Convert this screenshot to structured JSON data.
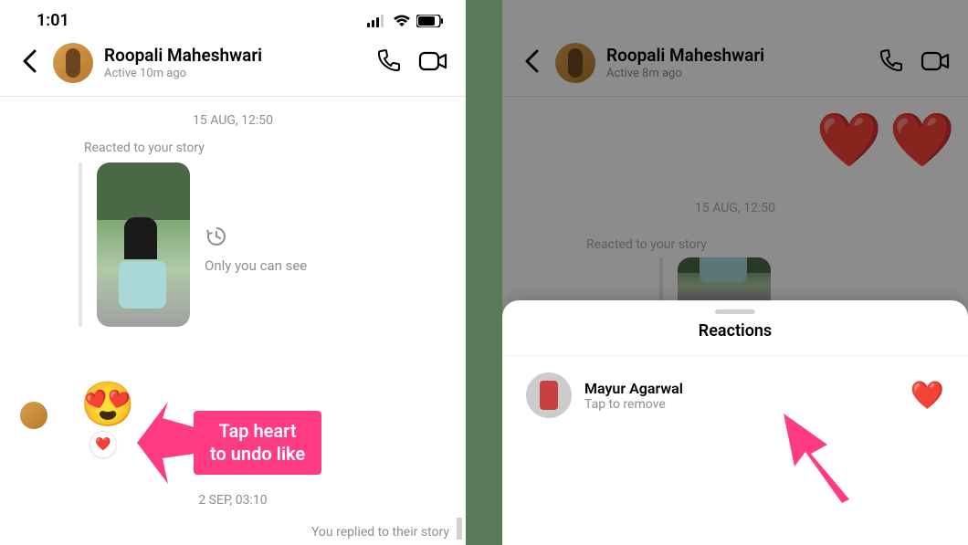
{
  "left": {
    "status": {
      "time": "1:01"
    },
    "header": {
      "name": "Roopali Maheshwari",
      "status": "Active 10m ago"
    },
    "timestamp1": "15 AUG, 12:50",
    "reacted_label": "Reacted to your story",
    "only_you": "Only you can see",
    "emoji_reaction": "😍",
    "heart_badge_icon": "❤️",
    "callout_line1": "Tap heart",
    "callout_line2": "to undo like",
    "timestamp2": "2 SEP, 03:10",
    "replied_label": "You replied to their story"
  },
  "right": {
    "header": {
      "name": "Roopali Maheshwari",
      "status": "Active 8m ago"
    },
    "hearts": [
      "❤️",
      "❤️"
    ],
    "timestamp1": "15 AUG, 12:50",
    "reacted_label": "Reacted to your story",
    "sheet": {
      "title": "Reactions",
      "row": {
        "name": "Mayur Agarwal",
        "sub": "Tap to remove",
        "heart": "❤️"
      }
    }
  }
}
